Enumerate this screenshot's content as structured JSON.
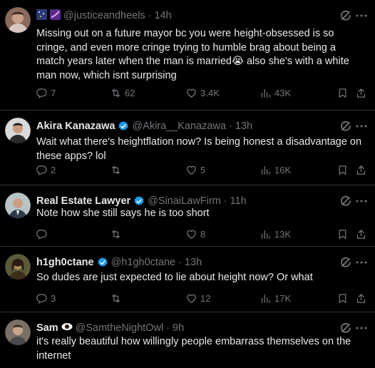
{
  "posts": [
    {
      "handle": "@justiceandheels",
      "time": "14h",
      "text": "Missing out on a future mayor bc you were height-obsessed is so cringe, and even more cringe trying to humble brag about being a match years later when the man is married😭 also she's with a white man now, which isnt surprising",
      "replies": "7",
      "reposts": "62",
      "likes": "3.4K",
      "views": "43K"
    },
    {
      "name": "Akira Kanazawa",
      "handle": "@Akira__Kanazawa",
      "time": "13h",
      "text": "Wait what there's heightflation now? Is being honest a disadvantage on these apps? lol",
      "replies": "2",
      "reposts": "",
      "likes": "5",
      "views": "16K"
    },
    {
      "name": "Real Estate Lawyer",
      "handle": "@SinaiLawFirm",
      "time": "11h",
      "text": "Note how she still says he is too short",
      "replies": "",
      "reposts": "",
      "likes": "8",
      "views": "13K"
    },
    {
      "name": "h1gh0ctane",
      "handle": "@h1gh0ctane",
      "time": "13h",
      "text": "So dudes are just expected to lie about height now? Or what",
      "replies": "3",
      "reposts": "",
      "likes": "12",
      "views": "17K"
    },
    {
      "name": "Sam",
      "handle": "@SamtheNightOwl",
      "time": "9h",
      "text": "it's really beautiful how willingly people embarrass themselves on the internet"
    }
  ],
  "colors": {
    "background": "#000000",
    "text": "#e7e9ea",
    "muted": "#71767b",
    "verified": "#1d9bf0",
    "divider": "#2f3336"
  }
}
